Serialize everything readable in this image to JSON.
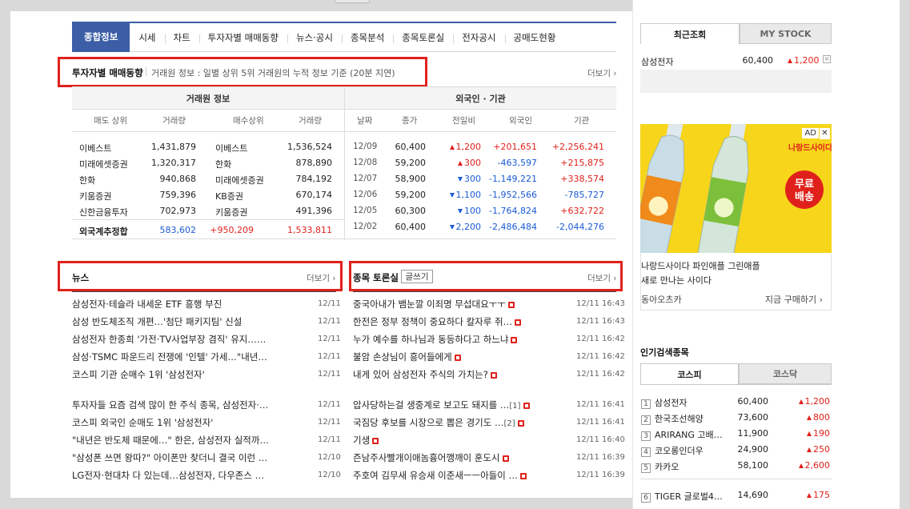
{
  "tabs": [
    "종합정보",
    "시세",
    "차트",
    "투자자별 매매동향",
    "뉴스·공시",
    "종목분석",
    "종목토론실",
    "전자공시",
    "공매도현황"
  ],
  "investor": {
    "title": "투자자별 매매동향",
    "desc": "거래원 정보 : 일별 상위 5위 거래원의 누적 정보 기준 (20분 지연)",
    "more": "더보기",
    "broker_header": "거래원 정보",
    "foreign_header": "외국인 · 기관",
    "broker_cols": [
      "매도 상위",
      "거래량",
      "매수상위",
      "거래량"
    ],
    "foreign_cols": [
      "날짜",
      "종가",
      "전일비",
      "외국인",
      "기관"
    ],
    "broker_rows": [
      [
        "이베스트",
        "1,431,879",
        "이베스트",
        "1,536,524"
      ],
      [
        "미래에셋증권",
        "1,320,317",
        "한화",
        "878,890"
      ],
      [
        "한화",
        "940,868",
        "미래에셋증권",
        "784,192"
      ],
      [
        "키움증권",
        "759,396",
        "KB증권",
        "670,174"
      ],
      [
        "신한금융투자",
        "702,973",
        "키움증권",
        "491,396"
      ]
    ],
    "broker_total": [
      "외국계추정합",
      "583,602",
      "+950,209",
      "1,533,811"
    ],
    "foreign_rows": [
      [
        "12/09",
        "60,400",
        "1,200",
        "+201,651",
        "+2,256,241"
      ],
      [
        "12/08",
        "59,200",
        "300",
        "-463,597",
        "+215,875"
      ],
      [
        "12/07",
        "58,900",
        "300",
        "-1,149,221",
        "+338,574"
      ],
      [
        "12/06",
        "59,200",
        "1,100",
        "-1,952,566",
        "-785,727"
      ],
      [
        "12/05",
        "60,300",
        "100",
        "-1,764,824",
        "+632,722"
      ],
      [
        "12/02",
        "60,400",
        "2,200",
        "-2,486,484",
        "-2,044,276"
      ]
    ]
  },
  "news": {
    "title": "뉴스",
    "more": "더보기",
    "items": [
      [
        "삼성전자·테슬라 내세운 ETF 흥행 부진",
        "12/11"
      ],
      [
        "삼성 반도체조직 개편…'첨단 패키지팀' 신설",
        "12/11"
      ],
      [
        "삼성전자 한종희 '가전·TV사업부장 겸직' 유지……",
        "12/11"
      ],
      [
        "삼성·TSMC 파운드리 전쟁에 '인텔' 가세…\"내년…",
        "12/11"
      ],
      [
        "코스피 기관 순매수 1위 '삼성전자'",
        "12/11"
      ],
      [
        "투자자들 요즘 검색 많이 한 주식 종목, 삼성전자·…",
        "12/11"
      ],
      [
        "코스피 외국인 순매도 1위 '삼성전자'",
        "12/11"
      ],
      [
        "\"내년은 반도체 때문에…\" 한은, 삼성전자 실적까…",
        "12/11"
      ],
      [
        "\"삼성폰 쓰면 왕따?\" 아이폰만 찾더니 결국 이런 …",
        "12/10"
      ],
      [
        "LG전자·현대차 다 있는데…삼성전자, 다우존스 …",
        "12/10"
      ]
    ]
  },
  "board": {
    "title": "종목 토론실",
    "write": "글쓰기",
    "more": "더보기",
    "items": [
      [
        "중국아내가 뱀눈깔 이죄명 무섭대요ㅜㅜ",
        "",
        "12/11 16:43"
      ],
      [
        "한전은 정부 정책이 중요하다 칼자루 쥐…",
        "",
        "12/11 16:43"
      ],
      [
        "누가 예수를 하나님과 동등하다고 하느냐",
        "",
        "12/11 16:42"
      ],
      [
        "불암 손상님이 흥어들에게",
        "",
        "12/11 16:42"
      ],
      [
        "내게 있어 삼성전자 주식의 가치는?",
        "",
        "12/11 16:42"
      ],
      [
        "압사당하는걸 생중계로 보고도 돼지를 …",
        "[1]",
        "12/11 16:41"
      ],
      [
        "국짐당 후보를 시장으로 뽑은 경기도 …",
        "[2]",
        "12/11 16:41"
      ],
      [
        "기생",
        "",
        "12/11 16:40"
      ],
      [
        "즌남주사빨개이애놈흉어깽깨이 훈도시",
        "",
        "12/11 16:39"
      ],
      [
        "주호여 김무새 유승새 이준새ㅡㅡ아들이 …",
        "",
        "12/11 16:39"
      ]
    ]
  },
  "right": {
    "tab_recent": "최근조회",
    "tab_mystock": "MY STOCK",
    "recent": {
      "name": "삼성전자",
      "price": "60,400",
      "change": "1,200",
      "close": "×"
    },
    "ad": {
      "badge": "AD",
      "brand": "나랑드사이다",
      "promo_line1": "무료",
      "promo_line2": "배송",
      "product": "나랑드사이다 파인애플 그린애플",
      "slogan": "새로 만나는 사이다",
      "seller": "동아오츠카",
      "cta": "지금 구매하기"
    },
    "popular_title": "인기검색종목",
    "popular_tabs": [
      "코스피",
      "코스닥"
    ],
    "popular": [
      [
        "1",
        "삼성전자",
        "60,400",
        "1,200"
      ],
      [
        "2",
        "한국조선해양",
        "73,600",
        "800"
      ],
      [
        "3",
        "ARIRANG 고배…",
        "11,900",
        "190"
      ],
      [
        "4",
        "코오롱인더우",
        "24,900",
        "250"
      ],
      [
        "5",
        "카카오",
        "58,100",
        "2,600"
      ],
      [
        "6",
        "TIGER 글로벌4…",
        "14,690",
        "175"
      ]
    ]
  },
  "colors": {
    "accent": "#3b5ea6",
    "up": "#e0211b",
    "down": "#1a5bd6",
    "highlight_box": "#e0211b"
  }
}
